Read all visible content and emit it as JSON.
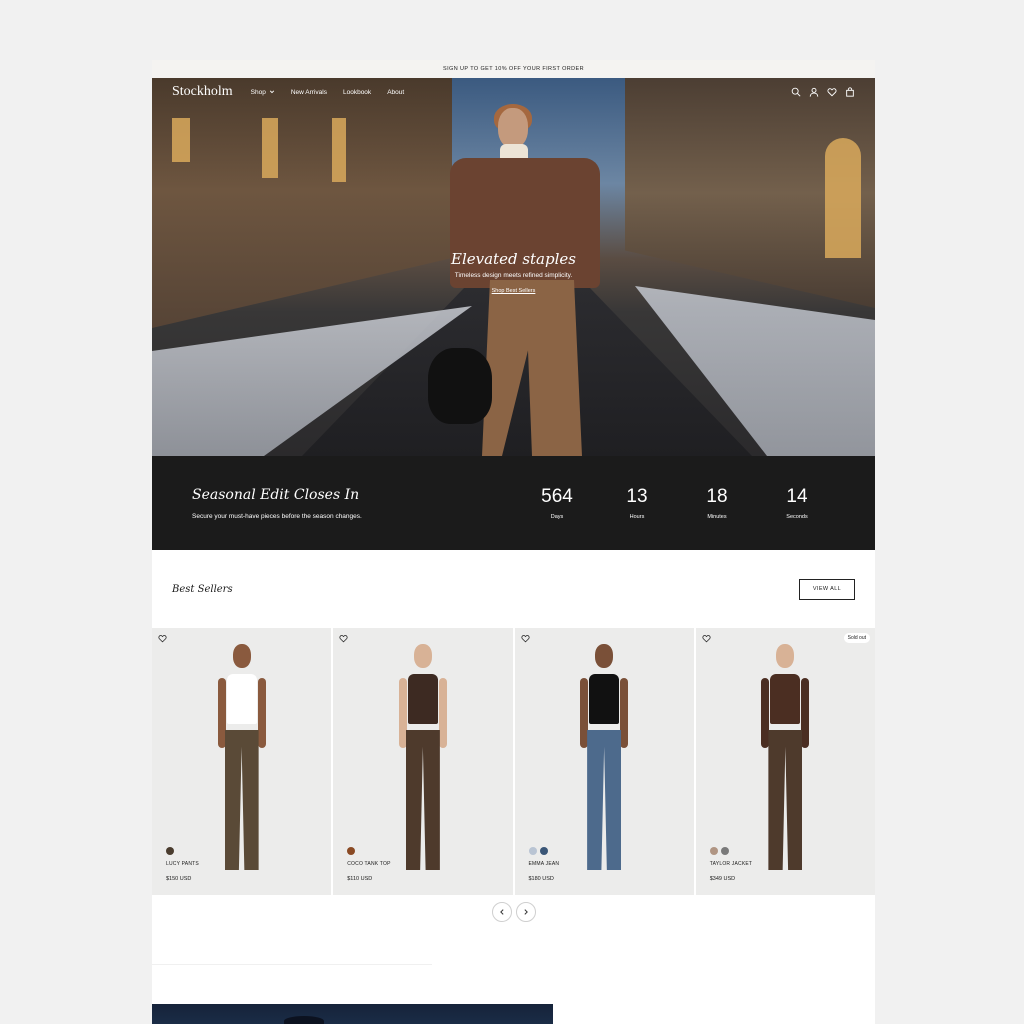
{
  "announcement": "SIGN UP TO GET 10% OFF YOUR FIRST ORDER",
  "nav": {
    "logo": "Stockholm",
    "links": [
      "Shop",
      "New Arrivals",
      "Lookbook",
      "About"
    ],
    "icons": [
      "search-icon",
      "account-icon",
      "wishlist-icon",
      "cart-icon"
    ]
  },
  "hero": {
    "title": "Elevated staples",
    "subtitle": "Timeless design meets refined simplicity.",
    "cta": "Shop Best Sellers"
  },
  "countdown": {
    "title": "Seasonal Edit Closes In",
    "subtitle": "Secure your must-have pieces before the season changes.",
    "units": [
      {
        "value": "564",
        "label": "Days"
      },
      {
        "value": "13",
        "label": "Hours"
      },
      {
        "value": "18",
        "label": "Minutes"
      },
      {
        "value": "14",
        "label": "Seconds"
      }
    ]
  },
  "best_sellers": {
    "title": "Best Sellers",
    "view_all": "VIEW ALL",
    "products": [
      {
        "name": "LUCY PANTS",
        "price": "$150 USD",
        "sold_out": "",
        "swatches": [
          "#4a3c2e"
        ],
        "top": "#ffffff",
        "bottom": "#5a4a37",
        "skin": "#8a5a3e"
      },
      {
        "name": "COCO TANK TOP",
        "price": "$110 USD",
        "sold_out": "",
        "swatches": [
          "#8a4a24"
        ],
        "top": "#3d2a22",
        "bottom": "#4e3a2c",
        "skin": "#d8b296"
      },
      {
        "name": "EMMA JEAN",
        "price": "$180 USD",
        "sold_out": "",
        "swatches": [
          "#b9c4d3",
          "#3a5677"
        ],
        "top": "#111111",
        "bottom": "#4d6a8c",
        "skin": "#7a5038"
      },
      {
        "name": "TAYLOR JACKET",
        "price": "$349 USD",
        "sold_out": "Sold out",
        "swatches": [
          "#b09583",
          "#7a7a7a"
        ],
        "top": "#4b2e22",
        "bottom": "#4e3a2c",
        "skin": "#d8b296"
      }
    ]
  },
  "colors": {
    "countdown_bg": "#1b1b1b",
    "page_bg": "#f1f1f1",
    "card_bg": "#ececeb"
  }
}
